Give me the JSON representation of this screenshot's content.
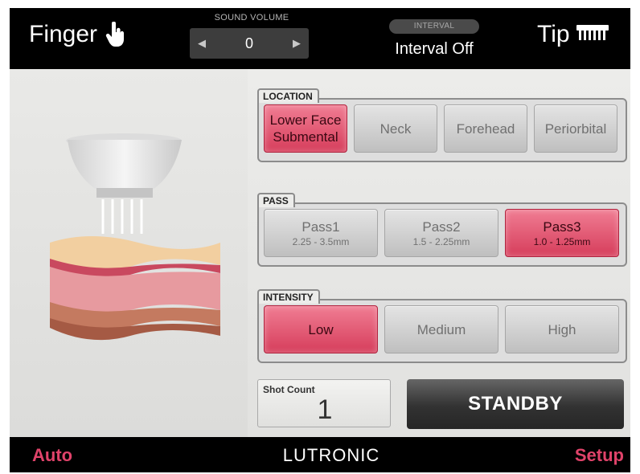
{
  "header": {
    "mode_left": "Finger",
    "mode_left_icon": "hand-pointer-icon",
    "volume_title": "SOUND VOLUME",
    "volume_value": "0",
    "interval_badge": "INTERVAL",
    "interval_status": "Interval Off",
    "mode_right": "Tip",
    "mode_right_icon": "tip-comb-icon"
  },
  "location": {
    "label": "LOCATION",
    "options": [
      {
        "line1": "Lower Face",
        "line2": "Submental",
        "selected": true
      },
      {
        "line1": "Neck",
        "selected": false
      },
      {
        "line1": "Forehead",
        "selected": false
      },
      {
        "line1": "Periorbital",
        "selected": false
      }
    ]
  },
  "pass": {
    "label": "PASS",
    "options": [
      {
        "name": "Pass1",
        "range": "2.25 - 3.5mm",
        "selected": false
      },
      {
        "name": "Pass2",
        "range": "1.5 - 2.25mm",
        "selected": false
      },
      {
        "name": "Pass3",
        "range": "1.0 - 1.25mm",
        "selected": true
      }
    ]
  },
  "intensity": {
    "label": "INTENSITY",
    "options": [
      {
        "name": "Low",
        "selected": true
      },
      {
        "name": "Medium",
        "selected": false
      },
      {
        "name": "High",
        "selected": false
      }
    ]
  },
  "shot_count": {
    "label": "Shot Count",
    "value": "1"
  },
  "standby_label": "STANDBY",
  "footer": {
    "auto_label": "Auto",
    "brand": "LUTRONIC",
    "setup_label": "Setup"
  },
  "colors": {
    "accent_pink": "#d63d5b",
    "footer_red": "#e0436a",
    "bar_black": "#000000"
  }
}
